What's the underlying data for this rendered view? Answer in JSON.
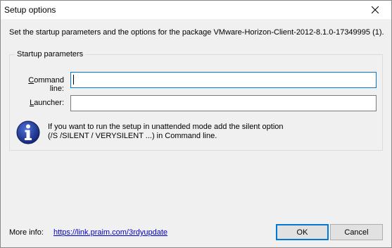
{
  "window": {
    "title": "Setup options"
  },
  "intro": {
    "text": "Set the startup parameters and the options for the package VMware-Horizon-Client-2012-8.1.0-17349995 (1)."
  },
  "startup_group": {
    "legend": "Startup parameters",
    "command_line": {
      "label_accel": "C",
      "label_rest": "ommand line:",
      "value": ""
    },
    "launcher": {
      "label_accel": "L",
      "label_rest": "auncher:",
      "value": ""
    },
    "info": {
      "icon": "info-icon",
      "line1": "If you want to run the setup in unattended mode add the silent option",
      "line2": "(/S /SILENT / VERYSILENT ...) in Command line."
    }
  },
  "footer": {
    "more_info_label": "More info:",
    "more_info_link": "https://link.praim.com/3rdyupdate",
    "ok_label": "OK",
    "cancel_label": "Cancel"
  },
  "colors": {
    "accent": "#0078d7",
    "dialog_bg": "#f0f0f0",
    "link": "#0000cc",
    "info_icon": "#1e3a8a"
  }
}
